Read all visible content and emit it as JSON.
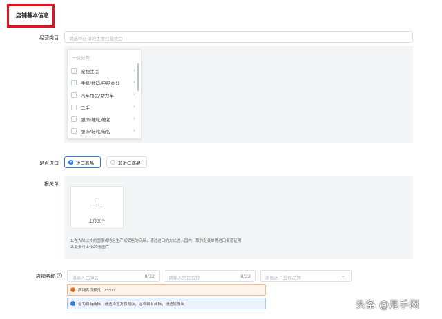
{
  "section": {
    "title": "店铺基本信息"
  },
  "category": {
    "label": "经营类目",
    "placeholder": "请选择店铺的主要经营类目",
    "dropdown": {
      "header": "一级分类",
      "items": [
        {
          "label": "宠物生活",
          "checked": false
        },
        {
          "label": "手机/数码/电脑办公",
          "checked": false
        },
        {
          "label": "汽车用品/助力车",
          "checked": false
        },
        {
          "label": "二手",
          "checked": false
        },
        {
          "label": "服饰/鞋靴/箱包",
          "checked": false
        },
        {
          "label": "服饰/鞋靴/箱包",
          "checked": false
        }
      ]
    }
  },
  "import": {
    "label": "是否进口",
    "options": [
      {
        "label": "进口商品",
        "selected": true
      },
      {
        "label": "非进口商品",
        "selected": false
      }
    ]
  },
  "customs": {
    "label": "报关单",
    "upload_label": "上传文件",
    "note1": "1.在大陆以外的国家或地区生产或销售的商品，通过进口的方式进入国内，取的报关单等进口渠道证明",
    "note2": "2.最多可上传20张图片"
  },
  "shop_name": {
    "label": "店铺名称",
    "brand_placeholder": "请输入品牌名",
    "brand_counter": "0/32",
    "category_placeholder": "请输入类目名称",
    "category_counter": "0/32",
    "store_type": "旗舰店：授权品牌",
    "preview_text": "店铺名称预览：xxxxx",
    "info_text": "若为自有商标，请选择官方旗舰店，若非自有商标，请选旗舰店"
  },
  "watermark": "头条 @甩手网",
  "colors": {
    "accent": "#2f7bf5",
    "highlight_box": "#e8101a",
    "warning": "#f26b1d",
    "panel_bg": "#f4f5f7"
  }
}
